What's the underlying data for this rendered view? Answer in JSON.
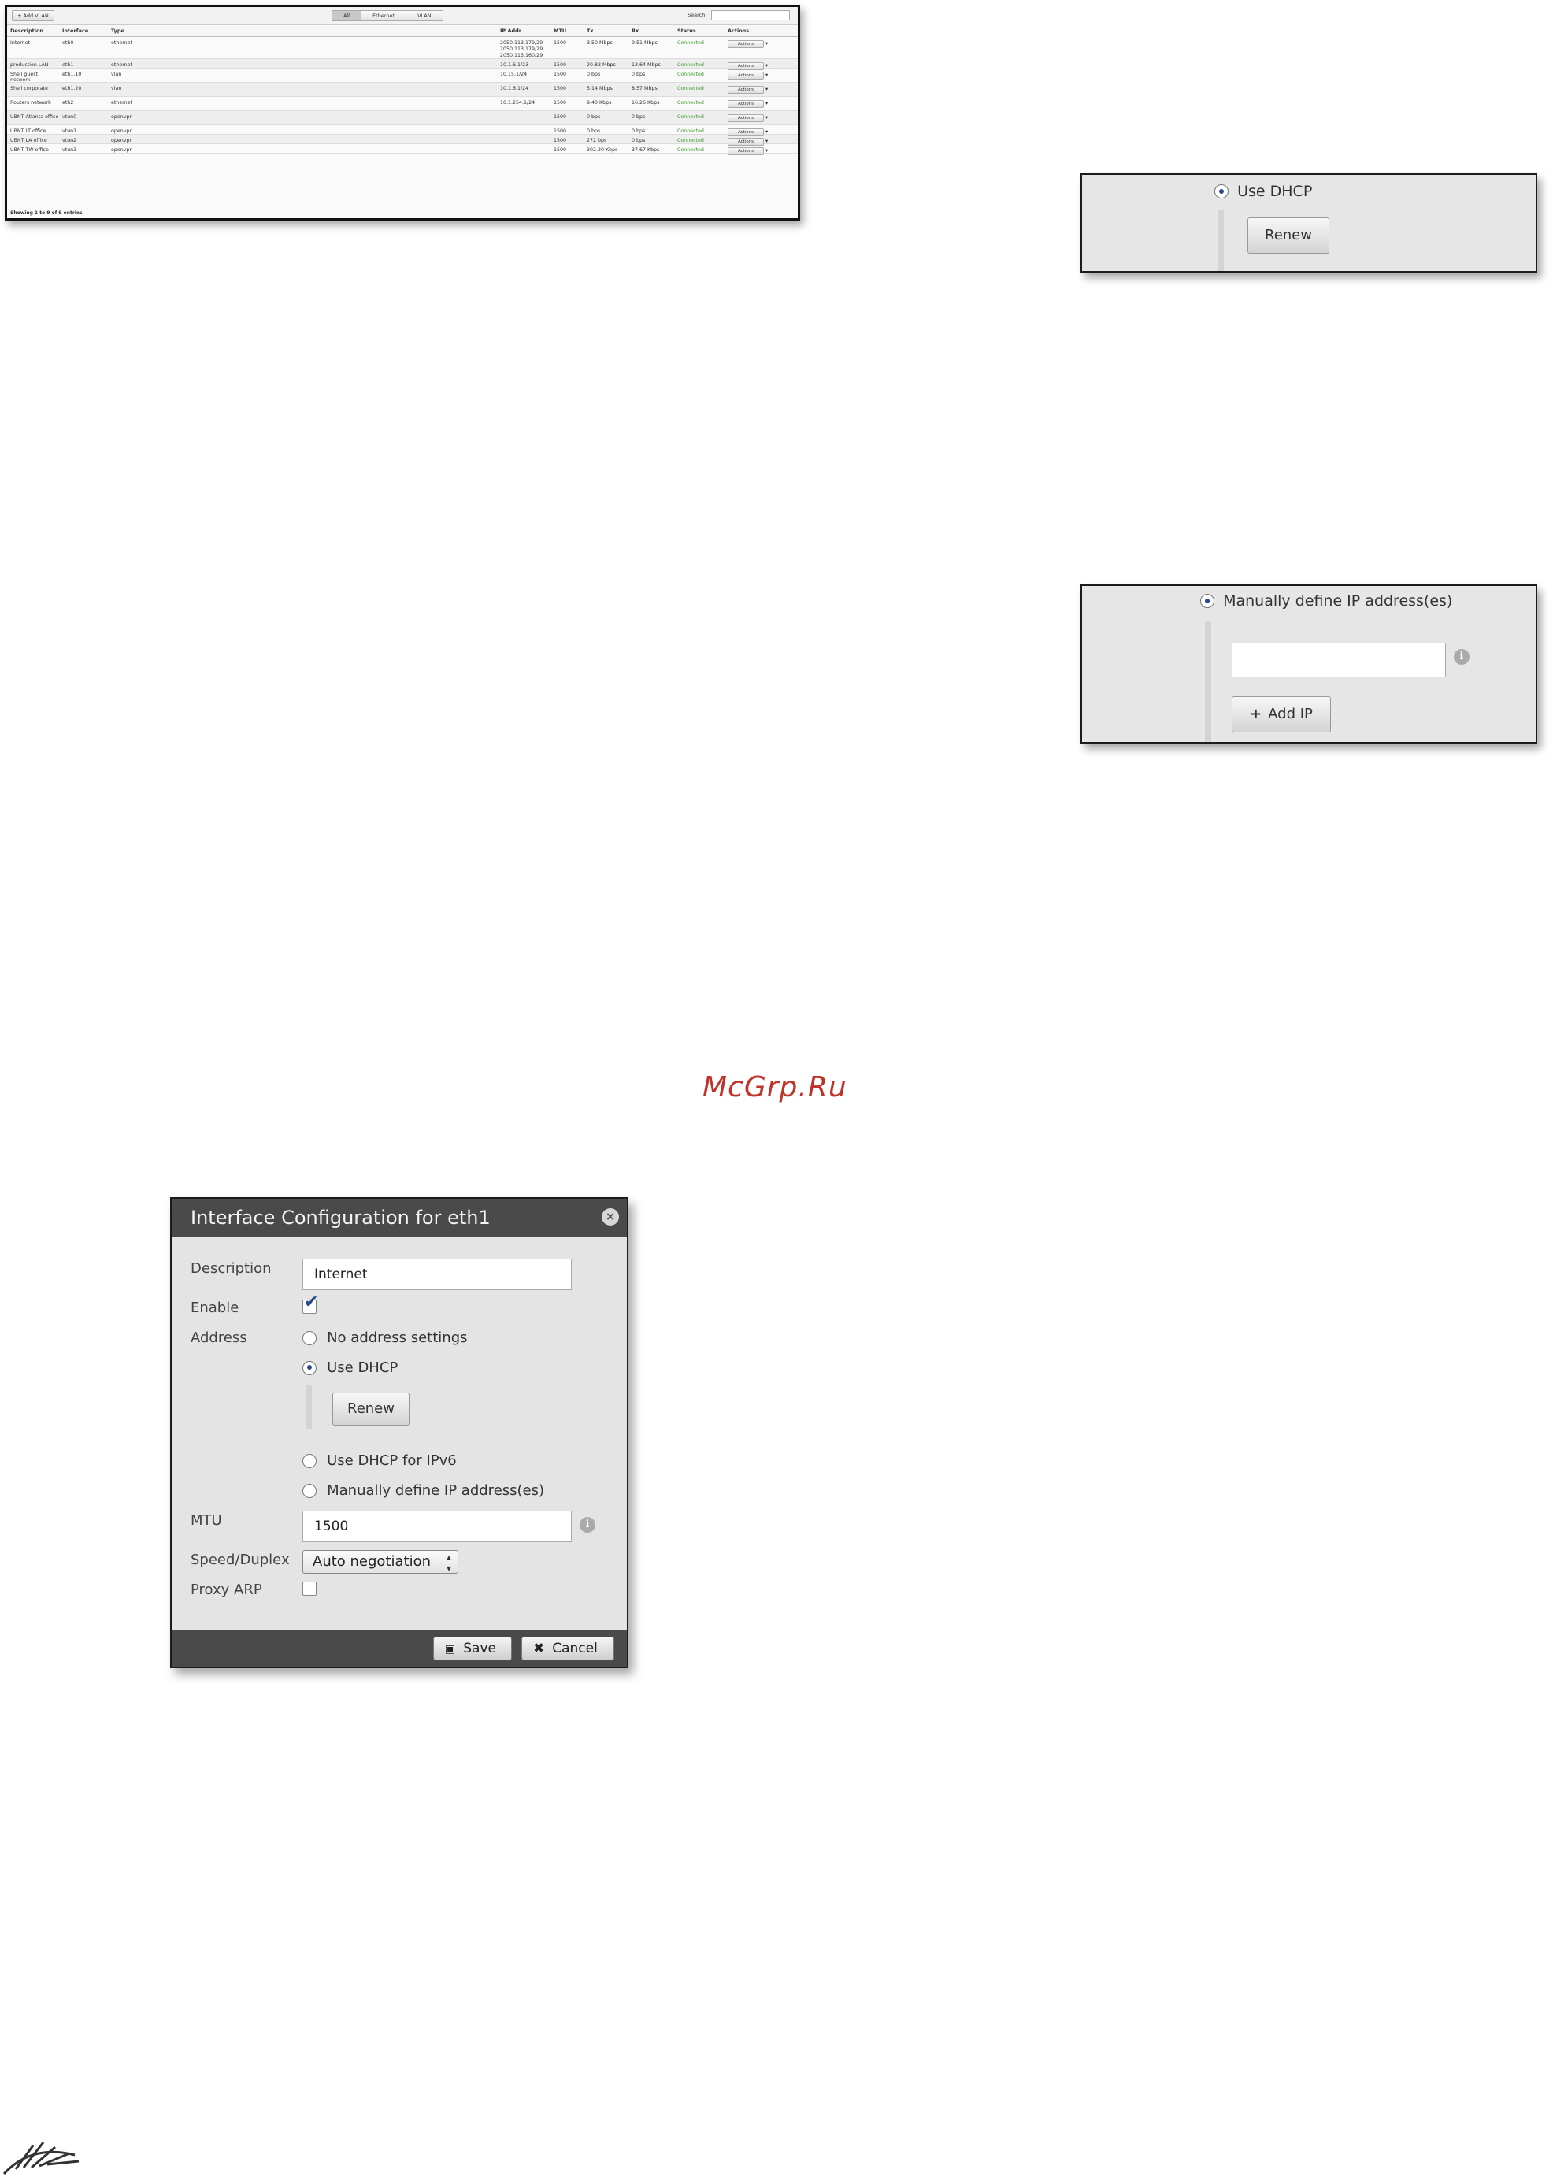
{
  "table": {
    "add_vlan_label": "+ Add VLAN",
    "filters": [
      "All",
      "Ethernet",
      "VLAN"
    ],
    "search_label": "Search:",
    "columns": [
      "Description",
      "Interface",
      "Type",
      "IP Addr",
      "MTU",
      "Tx",
      "Rx",
      "Status",
      "Actions"
    ],
    "rows": [
      {
        "desc": "Internet",
        "iface": "eth0",
        "type": "ethernet",
        "ip": [
          "2050.113.179/29",
          "2050.113.179/29",
          "2050.113.160/29"
        ],
        "mtu": "1500",
        "tx": "3.50 Mbps",
        "rx": "9.51 Mbps",
        "status": "Connected",
        "action": "Actions"
      },
      {
        "desc": "production LAN",
        "iface": "eth1",
        "type": "ethernet",
        "ip": [
          "10.1.6.1/23"
        ],
        "mtu": "1500",
        "tx": "20.83 Mbps",
        "rx": "13.64 Mbps",
        "status": "Connected",
        "action": "Actions"
      },
      {
        "desc": "Shell guest network",
        "iface": "eth1.10",
        "type": "vlan",
        "ip": [
          "10.15.1/24"
        ],
        "mtu": "1500",
        "tx": "0 bps",
        "rx": "0 bps",
        "status": "Connected",
        "action": "Actions"
      },
      {
        "desc": "Shell corporate",
        "iface": "eth1.20",
        "type": "vlan",
        "ip": [
          "10.1.6.1/24"
        ],
        "mtu": "1500",
        "tx": "5.14 Mbps",
        "rx": "8.57 Mbps",
        "status": "Connected",
        "action": "Actions"
      },
      {
        "desc": "Routers network",
        "iface": "eth2",
        "type": "ethernet",
        "ip": [
          "10.1.254.1/24"
        ],
        "mtu": "1500",
        "tx": "9.40 Kbps",
        "rx": "16.26 Kbps",
        "status": "Connected",
        "action": "Actions"
      },
      {
        "desc": "UBNT Atlanta office",
        "iface": "vtun0",
        "type": "openvpn",
        "ip": [],
        "mtu": "1500",
        "tx": "0 bps",
        "rx": "0 bps",
        "status": "Connected",
        "action": "Actions"
      },
      {
        "desc": "UBNT LT office",
        "iface": "vtun1",
        "type": "openvpn",
        "ip": [],
        "mtu": "1500",
        "tx": "0 bps",
        "rx": "0 bps",
        "status": "Connected",
        "action": "Actions"
      },
      {
        "desc": "UBNT LA office",
        "iface": "vtun2",
        "type": "openvpn",
        "ip": [],
        "mtu": "1500",
        "tx": "272 bps",
        "rx": "0 bps",
        "status": "Connected",
        "action": "Actions"
      },
      {
        "desc": "UBNT TW office",
        "iface": "vtun3",
        "type": "openvpn",
        "ip": [],
        "mtu": "1500",
        "tx": "302.30 Kbps",
        "rx": "37.67 Kbps",
        "status": "Connected",
        "action": "Actions"
      }
    ],
    "footer": "Showing 1 to 9 of 9 entries"
  },
  "dhcp_panel": {
    "radio_label": "Use DHCP",
    "renew_label": "Renew"
  },
  "manual_panel": {
    "radio_label": "Manually define IP address(es)",
    "input_value": "",
    "add_ip_label": "Add IP",
    "info_glyph": "i"
  },
  "watermark": "McGrp.Ru",
  "dialog": {
    "title": "Interface Configuration for eth1",
    "close_glyph": "×",
    "description_label": "Description",
    "description_value": "Internet",
    "enable_label": "Enable",
    "enable_checked": true,
    "address_label": "Address",
    "address_options": [
      "No address settings",
      "Use DHCP",
      "Use DHCP for IPv6",
      "Manually define IP address(es)"
    ],
    "address_selected": "Use DHCP",
    "renew_label": "Renew",
    "mtu_label": "MTU",
    "mtu_value": "1500",
    "speed_label": "Speed/Duplex",
    "speed_value": "Auto negotiation",
    "proxy_arp_label": "Proxy ARP",
    "proxy_arp_checked": false,
    "save_label": "Save",
    "cancel_label": "Cancel"
  },
  "colors": {
    "accent": "#25498a",
    "status_connected": "#3a9a2a",
    "dialog_bar": "#4a4a4a",
    "watermark": "#c0332b"
  },
  "icons": [
    "plus-icon",
    "info-icon",
    "close-icon",
    "save-icon",
    "cancel-icon",
    "dropdown-arrow-icon",
    "ubiquiti-logo"
  ]
}
